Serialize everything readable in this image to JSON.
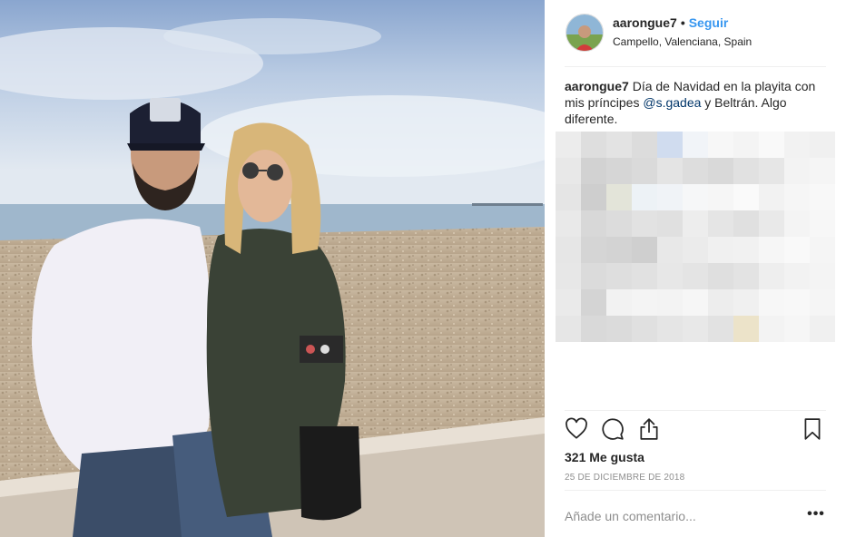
{
  "post": {
    "username": "aarongue7",
    "separator": "•",
    "follow_label": "Seguir",
    "location": "Campello, Valenciana, Spain"
  },
  "caption": {
    "username": "aarongue7",
    "text_part1": " Día de Navidad en la playita con mis príncipes ",
    "mention": "@s.gadea",
    "text_part2": " y Beltrán. Algo diferente."
  },
  "actions": {
    "like_icon": "heart-icon",
    "comment_icon": "comment-icon",
    "share_icon": "share-icon",
    "save_icon": "bookmark-icon"
  },
  "likes_label": "321 Me gusta",
  "date_label": "25 DE DICIEMBRE DE 2018",
  "comment": {
    "placeholder": "Añade un comentario...",
    "more_label": "•••"
  },
  "colors": {
    "link": "#3897f0",
    "mention": "#003569",
    "muted": "#8e8e8e",
    "text": "#262626"
  }
}
